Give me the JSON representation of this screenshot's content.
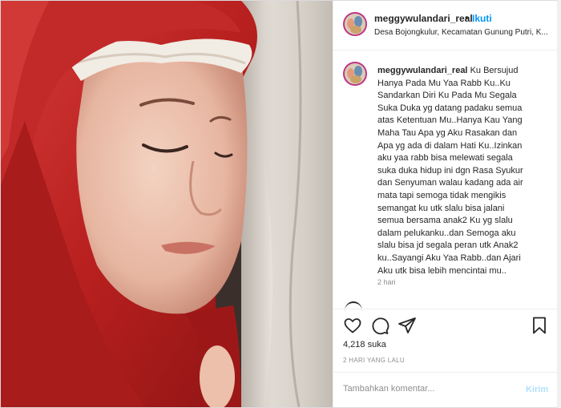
{
  "post": {
    "username": "meggywulandari_real",
    "separator": "•",
    "follow_label": "Ikuti",
    "location": "Desa Bojongkulur, Kecamatan Gunung Putri, K..."
  },
  "caption": {
    "username": "meggywulandari_real",
    "text": "Ku Bersujud\nHanya Pada Mu Yaa Rabb Ku..Ku\nSandarkan Diri Ku Pada Mu Segala\nSuka Duka yg datang padaku semua\natas Ketentuan Mu..Hanya Kau Yang\nMaha Tau Apa yg Aku Rasakan dan\nApa yg ada di dalam Hati Ku..Izinkan\naku yaa rabb bisa melewati segala\nsuka duka hidup ini dgn Rasa Syukur\ndan Senyuman walau kadang ada air\nmata tapi semoga tidak mengikis\nsemangat ku utk slalu bisa jalani\nsemua bersama anak2 Ku yg slalu\ndalam pelukanku..dan Semoga aku\nslalu bisa jd segala peran utk Anak2\nku..Sayangi Aku Yaa Rabb..dan Ajari\nAku utk bisa lebih mencintai mu..",
    "time": "2 hari"
  },
  "stats": {
    "likes": "4,218 suka",
    "posted_ago": "2 HARI YANG LALU"
  },
  "comment": {
    "placeholder": "Tambahkan komentar...",
    "post_label": "Kirim"
  },
  "icons": {
    "like": "heart-icon",
    "comment": "comment-icon",
    "share": "share-icon",
    "save": "bookmark-icon"
  },
  "colors": {
    "follow": "#0095f6",
    "post_disabled": "#b2dffc",
    "hijab": "#c2282b"
  }
}
